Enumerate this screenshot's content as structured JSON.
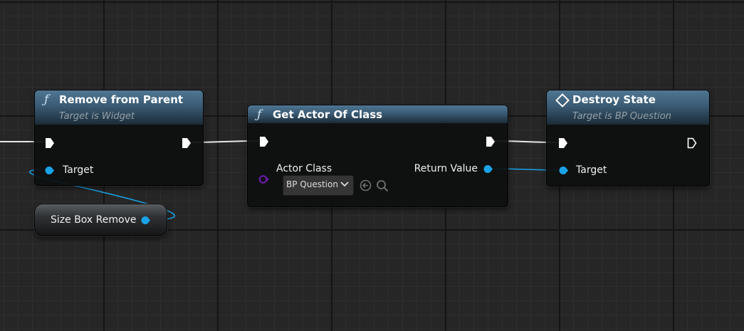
{
  "nodes": {
    "remove_from_parent": {
      "title": "Remove from Parent",
      "subtitle": "Target is Widget",
      "pin_target": "Target"
    },
    "get_actor_of_class": {
      "title": "Get Actor Of Class",
      "pin_actor_class": "Actor Class",
      "actor_class_value": "BP Question",
      "pin_return_value": "Return Value"
    },
    "destroy_state": {
      "title": "Destroy State",
      "subtitle": "Target is BP Question",
      "pin_target": "Target"
    },
    "size_box_remove": {
      "label": "Size Box Remove"
    }
  },
  "colors": {
    "canvas_bg": "#262626",
    "node_header": "#3a5b74",
    "object_pin": "#1aa3e8",
    "class_pin": "#6a1aa8",
    "exec_pin": "#ffffff"
  },
  "icons": [
    "function-icon",
    "event-icon",
    "exec-pin-icon",
    "object-pin-icon",
    "class-pin-icon",
    "chevron-down-icon",
    "use-selected-icon",
    "browse-icon"
  ]
}
